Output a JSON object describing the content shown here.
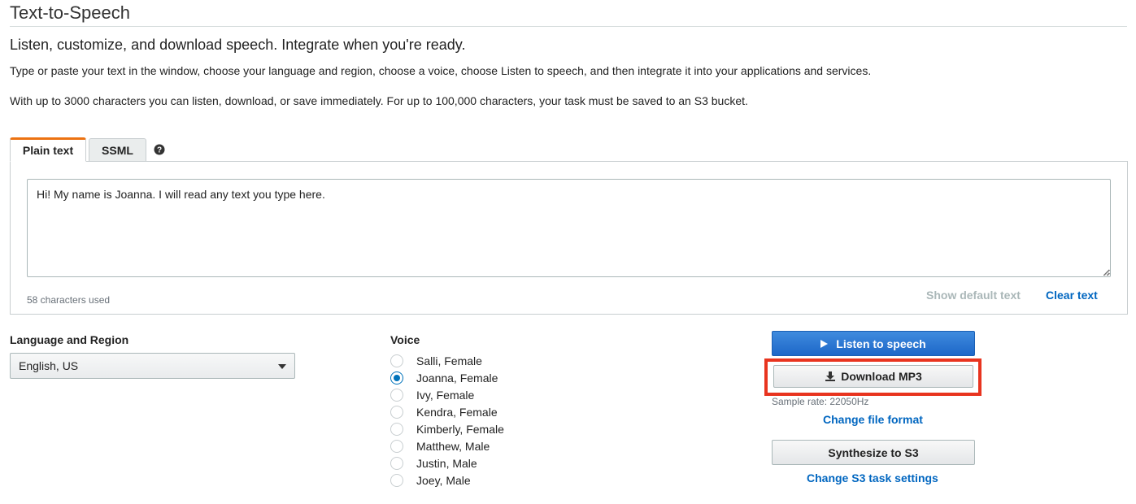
{
  "page": {
    "title": "Text-to-Speech",
    "subtitle": "Listen, customize, and download speech. Integrate when you're ready.",
    "description_1": "Type or paste your text in the window, choose your language and region, choose a voice, choose Listen to speech, and then integrate it into your applications and services.",
    "description_2": "With up to 3000 characters you can listen, download, or save immediately. For up to 100,000 characters, your task must be saved to an S3 bucket."
  },
  "tabs": [
    {
      "label": "Plain text",
      "active": true
    },
    {
      "label": "SSML",
      "active": false
    }
  ],
  "editor": {
    "value": "Hi! My name is Joanna. I will read any text you type here.",
    "char_count": "58 characters used",
    "show_default_label": "Show default text",
    "clear_label": "Clear text"
  },
  "language": {
    "label": "Language and Region",
    "selected": "English, US"
  },
  "voice": {
    "label": "Voice",
    "options": [
      {
        "label": "Salli, Female",
        "selected": false
      },
      {
        "label": "Joanna, Female",
        "selected": true
      },
      {
        "label": "Ivy, Female",
        "selected": false
      },
      {
        "label": "Kendra, Female",
        "selected": false
      },
      {
        "label": "Kimberly, Female",
        "selected": false
      },
      {
        "label": "Matthew, Male",
        "selected": false
      },
      {
        "label": "Justin, Male",
        "selected": false
      },
      {
        "label": "Joey, Male",
        "selected": false
      }
    ]
  },
  "actions": {
    "listen_label": "Listen to speech",
    "download_label": "Download MP3",
    "sample_rate": "Sample rate: 22050Hz",
    "change_format_label": "Change file format",
    "synthesize_label": "Synthesize to S3",
    "change_s3_label": "Change S3 task settings"
  },
  "colors": {
    "primary_button": "#1d67c8",
    "link": "#0066c0",
    "tab_accent": "#ec7211",
    "highlight": "#e8341f"
  },
  "icons": {
    "help": "question-circle-icon",
    "play": "play-icon",
    "download": "download-icon",
    "dropdown": "caret-down-icon"
  }
}
